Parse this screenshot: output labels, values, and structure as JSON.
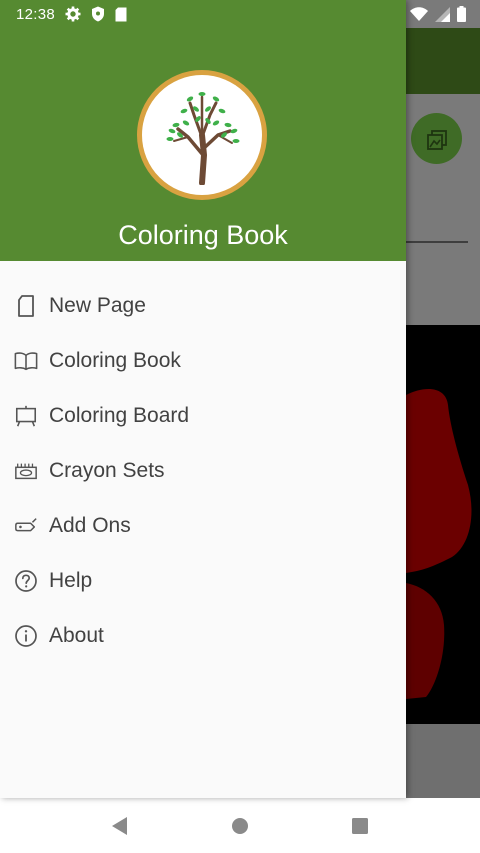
{
  "status_bar": {
    "time": "12:38",
    "left_icons": [
      "settings-icon",
      "shield-icon",
      "sd-card-icon"
    ],
    "right_icons": [
      "wifi-icon",
      "signal-icon",
      "battery-icon"
    ]
  },
  "drawer": {
    "header_color": "#568a31",
    "title": "Coloring Book",
    "logo": "tree-logo",
    "items": [
      {
        "label": "New Page",
        "icon": "page-icon"
      },
      {
        "label": "Coloring Book",
        "icon": "book-icon"
      },
      {
        "label": "Coloring Board",
        "icon": "easel-icon"
      },
      {
        "label": "Crayon Sets",
        "icon": "crayon-box-icon"
      },
      {
        "label": "Add Ons",
        "icon": "tag-icon"
      },
      {
        "label": "Help",
        "icon": "help-icon"
      },
      {
        "label": "About",
        "icon": "info-icon"
      }
    ]
  },
  "nav_bar": {
    "buttons": [
      "back-icon",
      "home-icon",
      "recents-icon"
    ]
  },
  "colors": {
    "accent": "#568a31",
    "logo_ring": "#d9a241",
    "menu_text": "#424242"
  }
}
